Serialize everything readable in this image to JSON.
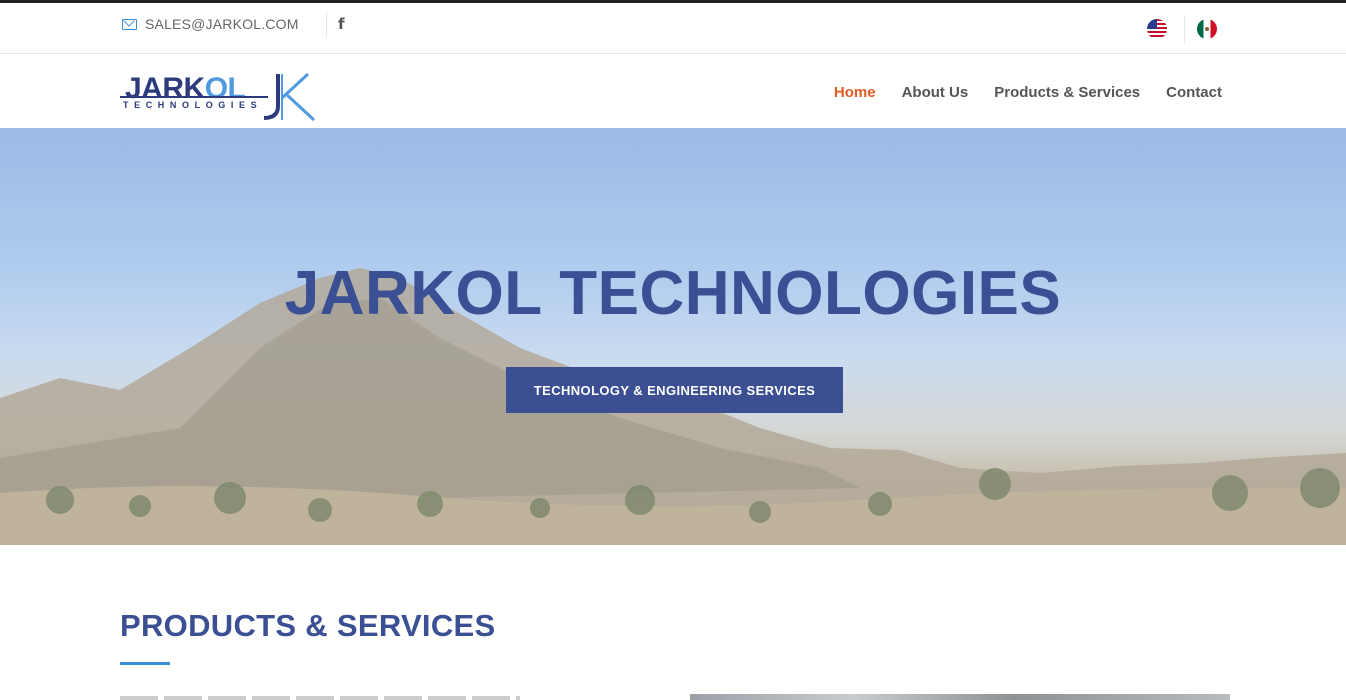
{
  "topbar": {
    "email": "SALES@JARKOL.COM",
    "email_icon": "mail-icon",
    "facebook_icon": "facebook-icon",
    "facebook_glyph": "f",
    "languages": [
      "English",
      "Español"
    ]
  },
  "header": {
    "logo_word_main": "JARKOL",
    "logo_subtitle": "TECHNOLOGIES",
    "nav": [
      "Home",
      "About Us",
      "Products & Services",
      "Contact"
    ],
    "active_nav": "Home"
  },
  "hero": {
    "title": "JARKOL TECHNOLOGIES",
    "button_label": "TECHNOLOGY & ENGINEERING SERVICES"
  },
  "section": {
    "title": "PRODUCTS & SERVICES"
  },
  "colors": {
    "brand_blue": "#3d4f93",
    "accent_blue": "#3b8fd6",
    "nav_active": "#e35b24"
  }
}
